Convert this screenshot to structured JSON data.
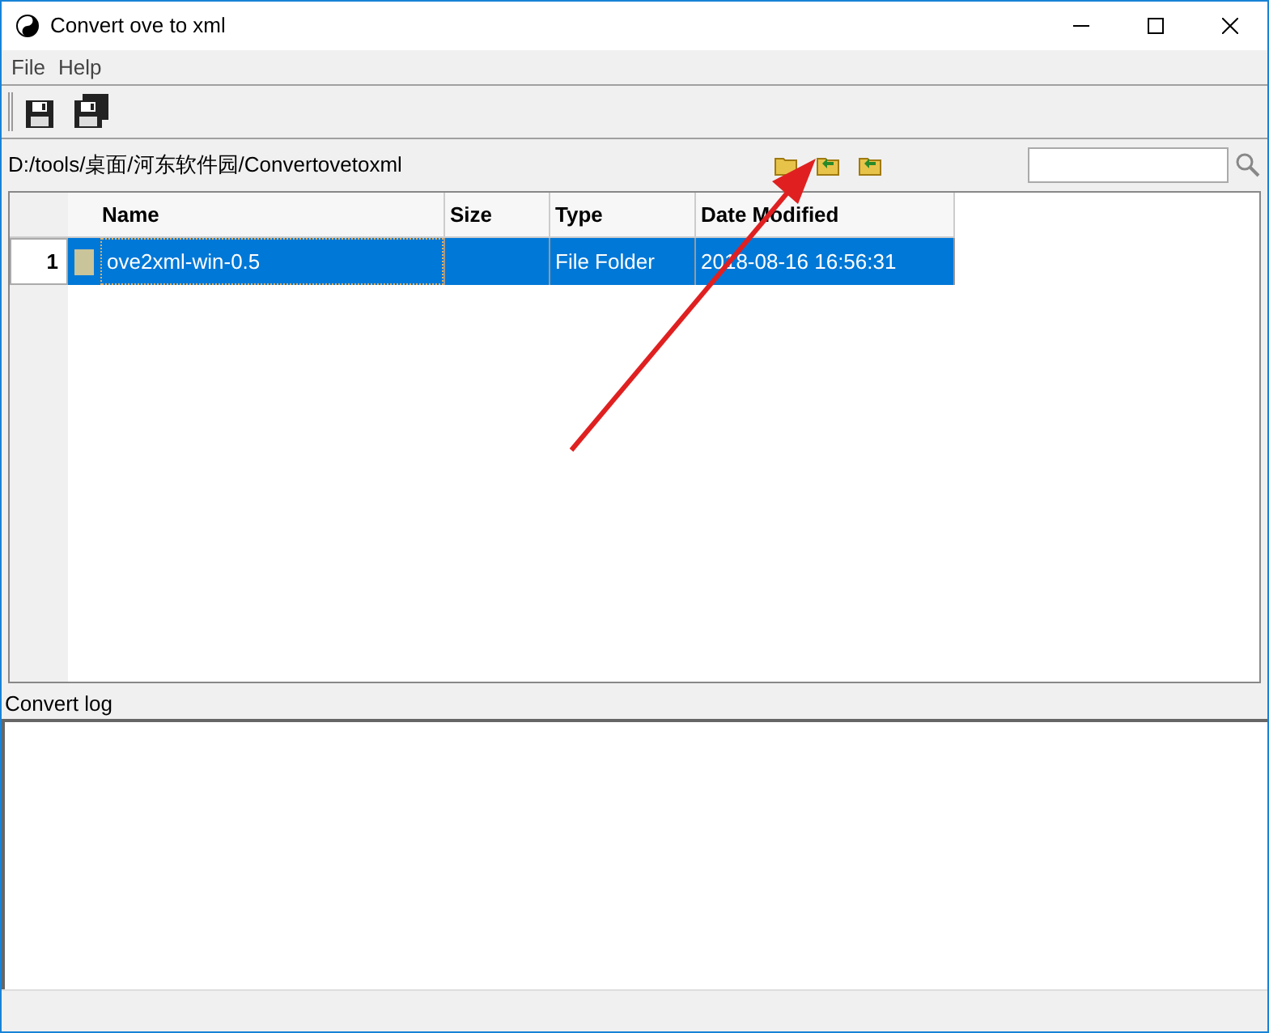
{
  "window": {
    "title": "Convert ove to xml"
  },
  "menu": [
    "File",
    "Help"
  ],
  "path": "D:/tools/桌面/河东软件园/Convertovetoxml",
  "table": {
    "columns": [
      "Name",
      "Size",
      "Type",
      "Date Modified"
    ],
    "rows": [
      {
        "number": "1",
        "cells": [
          "ove2xml-win-0.5",
          "",
          "File Folder",
          "2018-08-16 16:56:31"
        ],
        "selected": true
      }
    ]
  },
  "log": {
    "label": "Convert log"
  }
}
